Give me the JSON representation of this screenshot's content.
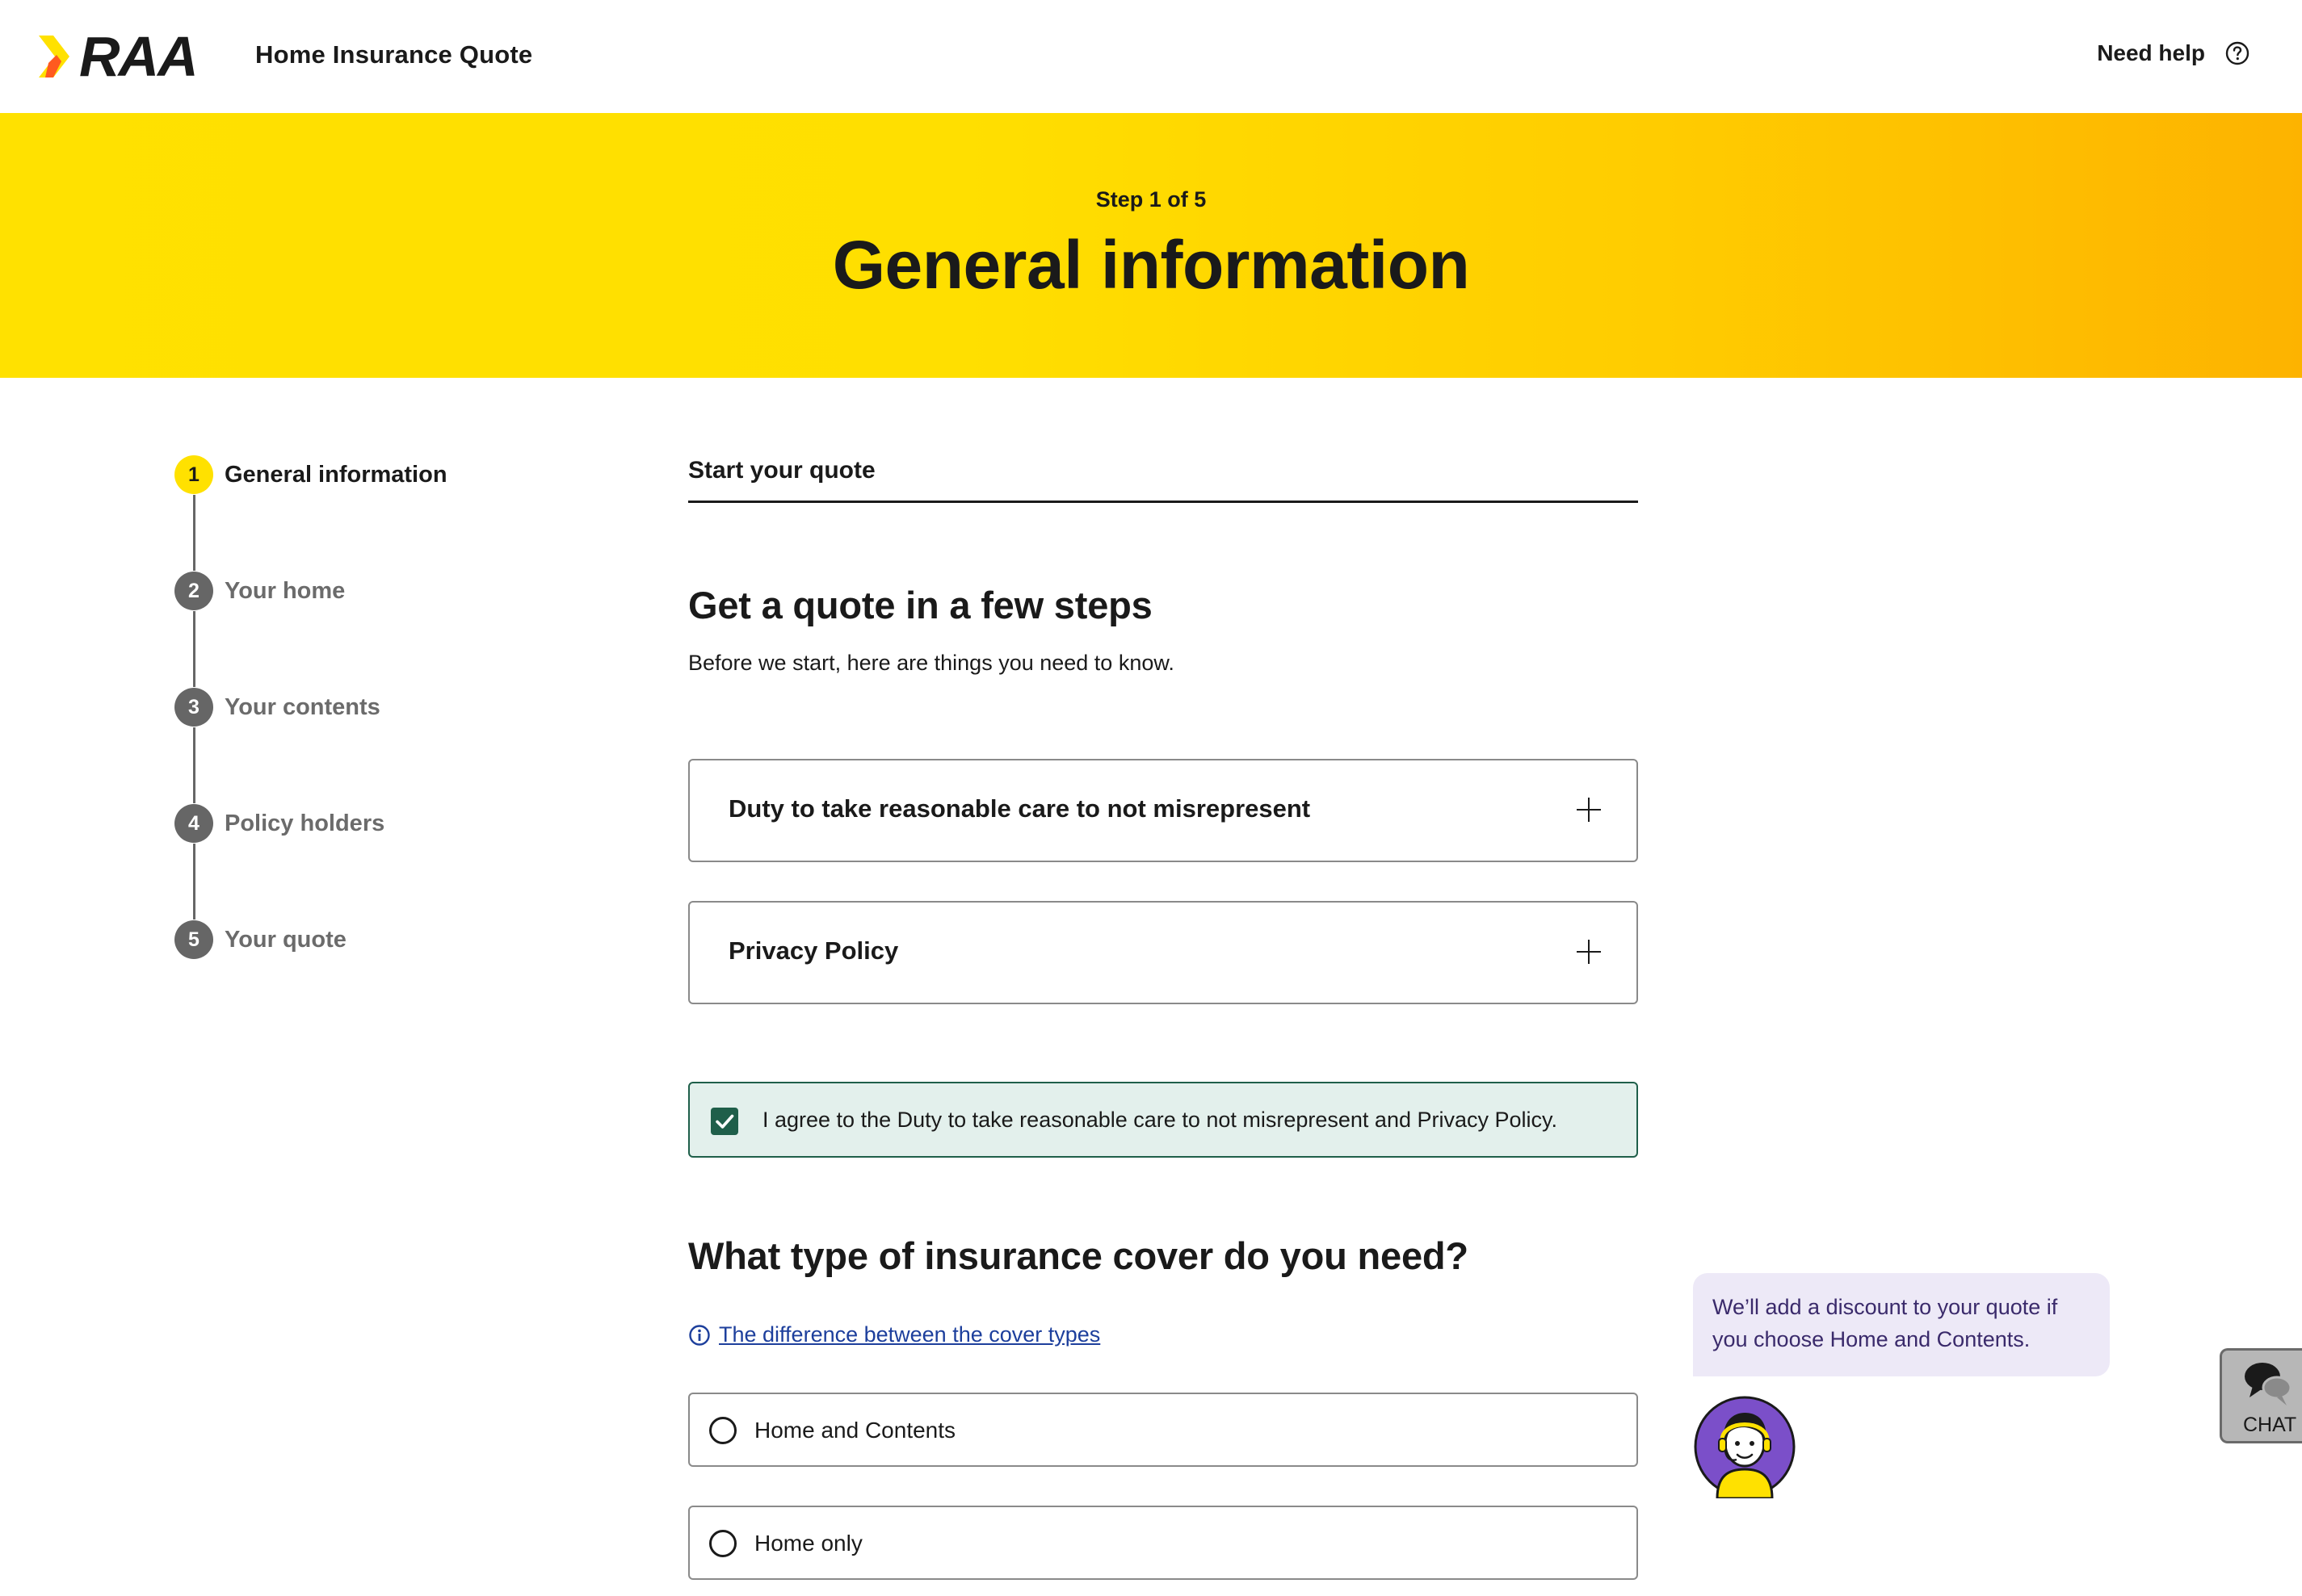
{
  "header": {
    "logo_text": "RAA",
    "app_title": "Home Insurance Quote",
    "help_label": "Need help"
  },
  "banner": {
    "step_count": "Step 1 of 5",
    "title": "General information"
  },
  "stepper": {
    "steps": [
      {
        "number": "1",
        "label": "General information",
        "active": true
      },
      {
        "number": "2",
        "label": "Your home",
        "active": false
      },
      {
        "number": "3",
        "label": "Your contents",
        "active": false
      },
      {
        "number": "4",
        "label": "Policy holders",
        "active": false
      },
      {
        "number": "5",
        "label": "Your quote",
        "active": false
      }
    ]
  },
  "main": {
    "section_tab": "Start your quote",
    "heading": "Get a quote in a few steps",
    "intro": "Before we start, here are things you need to know.",
    "accordions": [
      {
        "title": "Duty to take reasonable care to not misrepresent"
      },
      {
        "title": "Privacy Policy"
      }
    ],
    "agreement": {
      "checked": true,
      "text": "I agree to the Duty to take reasonable care to not misrepresent and Privacy Policy."
    },
    "cover_question": "What type of insurance cover do you need?",
    "cover_link": "The difference between the cover types",
    "cover_options": [
      {
        "label": "Home and Contents",
        "selected": false
      },
      {
        "label": "Home only",
        "selected": false
      }
    ]
  },
  "assistant": {
    "tip": "We’ll add a discount to your quote if you choose Home and Contents."
  },
  "chat_widget": {
    "label": "CHAT"
  },
  "colors": {
    "brand_yellow": "#ffe100",
    "banner_end": "#fdb300",
    "agree_green": "#1f5f4a",
    "agree_bg": "#e3f0ec",
    "link_blue": "#1d3f9c",
    "tip_bg": "#ede9f7",
    "avatar_purple": "#7b4fc9"
  },
  "icons": {
    "help": "question-circle-icon",
    "accordion_toggle": "plus-icon",
    "agreement": "checkmark-icon",
    "cover_link": "info-icon",
    "chat": "speech-bubbles-icon"
  }
}
